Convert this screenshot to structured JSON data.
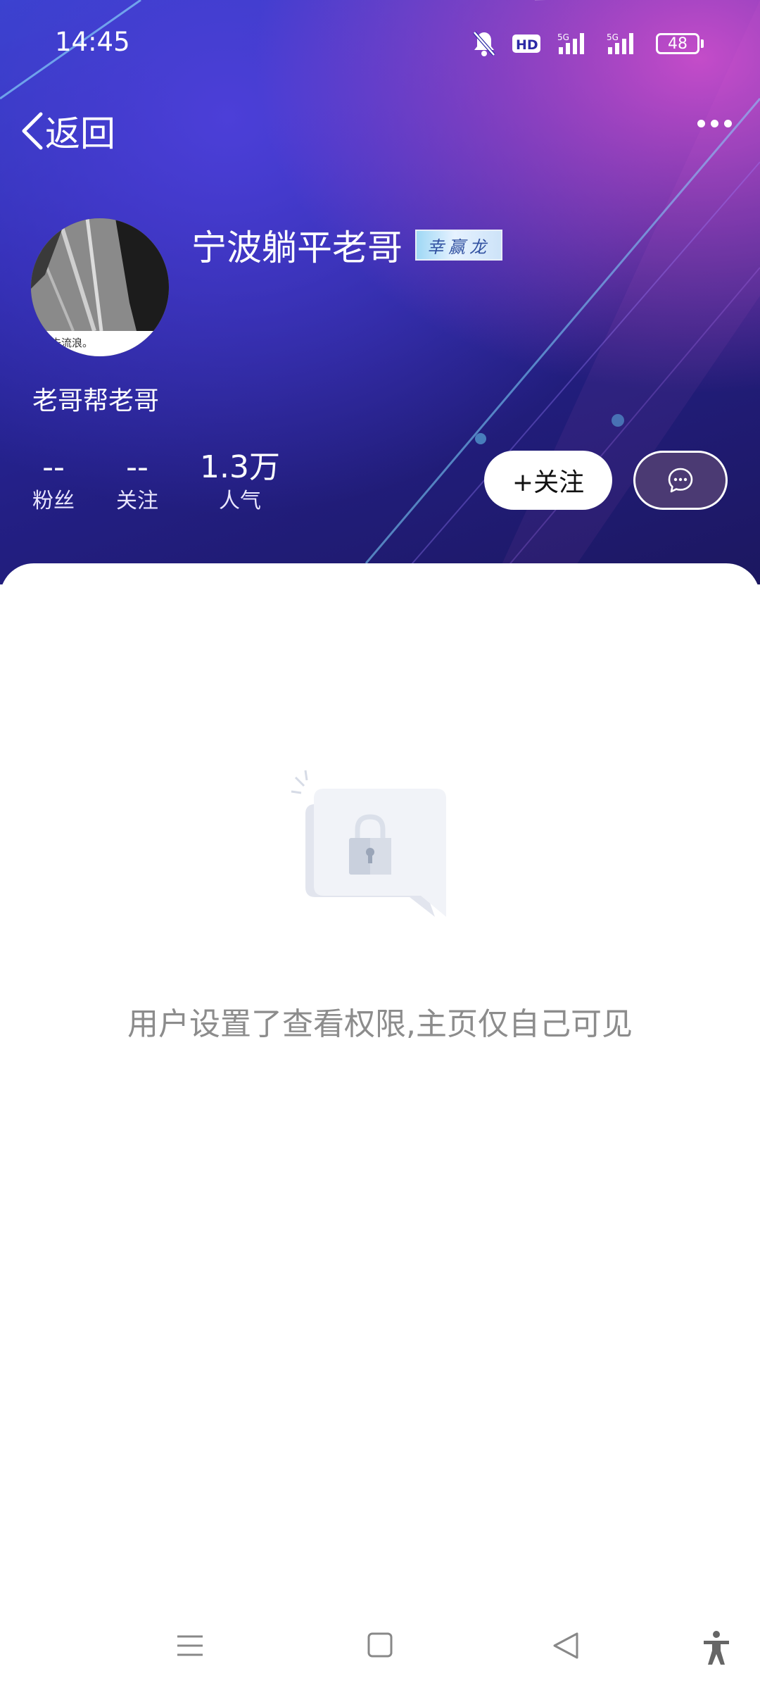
{
  "status_bar": {
    "time": "14:45",
    "hd_label": "HD",
    "net1": "5G",
    "net2": "5G",
    "battery": "48"
  },
  "topbar": {
    "back_label": "返回"
  },
  "profile": {
    "nickname": "宁波躺平老哥",
    "badge_text": "幸赢龙",
    "avatar_caption": "去流浪。",
    "signature": "老哥帮老哥",
    "stats": [
      {
        "value": "--",
        "label": "粉丝"
      },
      {
        "value": "--",
        "label": "关注"
      },
      {
        "value": "1.3万",
        "label": "人气"
      }
    ],
    "follow_label": "+关注"
  },
  "content": {
    "empty_message": "用户设置了查看权限,主页仅自己可见"
  },
  "colors": {
    "header_dark": "#1c1760",
    "header_accent": "#c44cc9",
    "message_button": "#4b3a73",
    "empty_text": "#8c8c8c"
  }
}
